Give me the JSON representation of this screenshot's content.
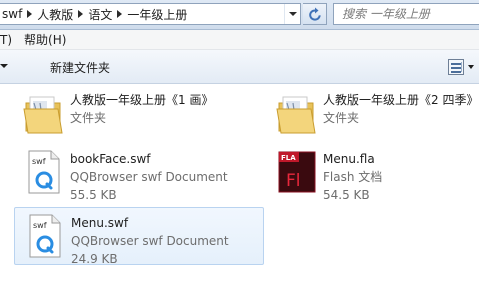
{
  "address": {
    "breadcrumb": [
      {
        "label": "swf"
      },
      {
        "label": "人教版"
      },
      {
        "label": "语文"
      },
      {
        "label": "一年级上册"
      }
    ],
    "search_placeholder": "搜索 一年级上册"
  },
  "menubar": {
    "items": [
      "T)",
      "帮助(H)"
    ]
  },
  "toolbar": {
    "new_folder_label": "新建文件夹"
  },
  "files": [
    {
      "name": "人教版一年级上册《1 画》",
      "type": "文件夹",
      "size": "",
      "icon": "folder-icon"
    },
    {
      "name": "人教版一年级上册《2 四季》",
      "type": "文件夹",
      "size": "",
      "icon": "folder-icon"
    },
    {
      "name": "bookFace.swf",
      "type": "QQBrowser swf Document",
      "size": "55.5 KB",
      "icon": "swf-file-icon"
    },
    {
      "name": "Menu.fla",
      "type": "Flash 文档",
      "size": "54.5 KB",
      "icon": "flash-fla-icon"
    },
    {
      "name": "Menu.swf",
      "type": "QQBrowser swf Document",
      "size": "24.9 KB",
      "icon": "swf-file-icon",
      "selected": true
    }
  ],
  "colors": {
    "selection_bg": "#e5f0fb",
    "selection_border": "#b9d3f0",
    "folder": "#e8c25a",
    "flash_red": "#c0182a",
    "secondary_text": "#6d6d6d"
  }
}
